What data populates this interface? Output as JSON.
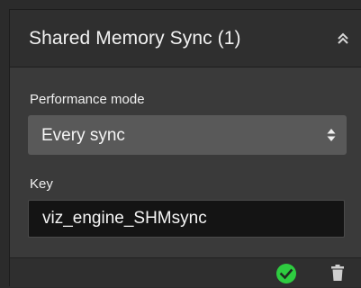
{
  "panel": {
    "title": "Shared Memory Sync (1)"
  },
  "performance_mode": {
    "label": "Performance mode",
    "selected": "Every sync"
  },
  "key": {
    "label": "Key",
    "value": "viz_engine_SHMsync"
  },
  "icons": {
    "collapse": "double-chevron-up-icon",
    "confirm": "check-circle-icon",
    "delete": "trash-icon",
    "select": "sort-arrows-icon"
  },
  "colors": {
    "confirm_green": "#2ecc40",
    "panel_bg": "#3a3a3a",
    "header_bg": "#2f2f2f",
    "select_bg": "#595959",
    "input_bg": "#141414"
  }
}
